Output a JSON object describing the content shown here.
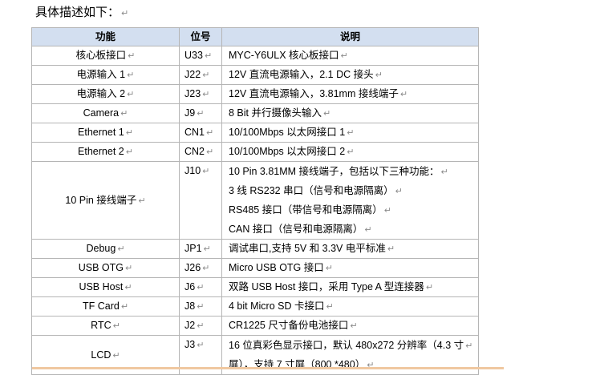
{
  "intro": "具体描述如下：",
  "para_mark": "↵",
  "headers": [
    "功能",
    "位号",
    "说明"
  ],
  "rows": [
    {
      "func": "核心板接口",
      "ref": "U33",
      "desc": [
        "MYC-Y6ULX 核心板接口"
      ]
    },
    {
      "func": "电源输入 1",
      "ref": "J22",
      "desc": [
        "12V 直流电源输入，2.1 DC 接头"
      ]
    },
    {
      "func": "电源输入 2",
      "ref": "J23",
      "desc": [
        "12V 直流电源输入，3.81mm 接线端子"
      ]
    },
    {
      "func": "Camera",
      "ref": "J9",
      "desc": [
        "8 Bit 并行摄像头输入"
      ]
    },
    {
      "func": "Ethernet 1",
      "ref": "CN1",
      "desc": [
        "10/100Mbps 以太网接口 1"
      ]
    },
    {
      "func": "Ethernet 2",
      "ref": "CN2",
      "desc": [
        "10/100Mbps 以太网接口 2"
      ]
    },
    {
      "func": "10 Pin 接线端子",
      "ref": "J10",
      "desc": [
        "10 Pin 3.81MM 接线端子，包括以下三种功能：",
        "3 线 RS232 串口（信号和电源隔离）",
        "RS485 接口（带信号和电源隔离）",
        "CAN 接口（信号和电源隔离）"
      ]
    },
    {
      "func": "Debug",
      "ref": "JP1",
      "desc": [
        "调试串口,支持 5V 和 3.3V 电平标准"
      ]
    },
    {
      "func": "USB OTG",
      "ref": "J26",
      "desc": [
        "Micro USB OTG 接口"
      ]
    },
    {
      "func": "USB Host",
      "ref": "J6",
      "desc": [
        "双路 USB Host 接口，采用 Type A 型连接器"
      ]
    },
    {
      "func": "TF Card",
      "ref": "J8",
      "desc": [
        "4 bit Micro SD 卡接口"
      ]
    },
    {
      "func": "RTC",
      "ref": "J2",
      "desc": [
        "CR1225 尺寸备份电池接口"
      ]
    },
    {
      "func": "LCD",
      "ref": "J3",
      "desc": [
        "16 位真彩色显示接口，默认 480x272 分辨率（4.3 寸",
        "屏），支持 7 寸屏（800 *480）"
      ]
    }
  ]
}
